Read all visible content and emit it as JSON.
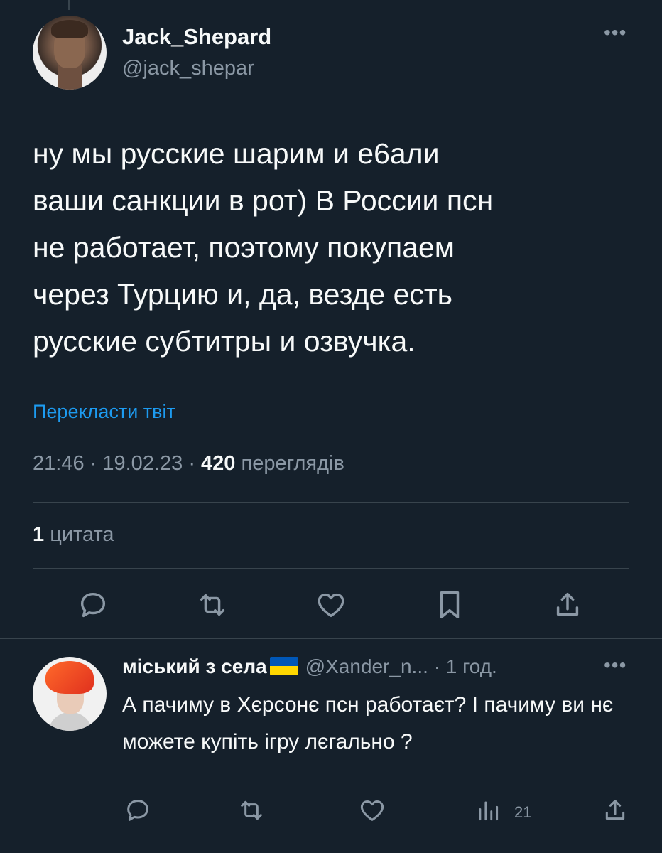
{
  "tweet": {
    "author_name": "Jack_Shepard",
    "author_handle": "@jack_shepar",
    "text": "ну мы русские шарим и е6али\nваши санкции в рот) В России псн\nне работает, поэтому покупаем\nчерез Турцию и, да, везде есть\nрусские субтитры и озвучка.",
    "translate_label": "Перекласти твіт",
    "time": "21:46",
    "date": "19.02.23",
    "views_count": "420",
    "views_label": "переглядів",
    "quotes_count": "1",
    "quotes_label": "цитата",
    "more_label": "•••"
  },
  "reply": {
    "author_name": "міський з села",
    "author_handle": "@Xander_n...",
    "separator": "·",
    "time_ago": "1 год.",
    "text": "А пачиму в Хєрсонє псн работаєт? І пачиму ви нє можете купіть ігру лєгально ?",
    "views_count": "21",
    "more_label": "•••"
  },
  "icons": {
    "reply": "comment-icon",
    "retweet": "retweet-icon",
    "like": "heart-icon",
    "bookmark": "bookmark-icon",
    "share": "share-icon",
    "views": "analytics-icon"
  },
  "colors": {
    "background": "#15202b",
    "text": "#f7f9f9",
    "secondary": "#8b98a5",
    "link": "#1d9bf0",
    "divider": "#38444d",
    "flag_blue": "#0057b7",
    "flag_yellow": "#ffd700"
  }
}
